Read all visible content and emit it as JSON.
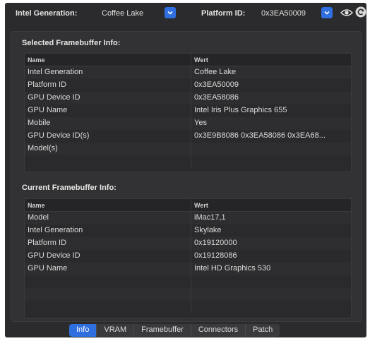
{
  "header": {
    "gen_label": "Intel Generation:",
    "gen_value": "Coffee Lake",
    "platform_label": "Platform ID:",
    "platform_value": "0x3EA50009"
  },
  "selected": {
    "title": "Selected Framebuffer Info:",
    "col_name": "Name",
    "col_value": "Wert",
    "rows": [
      {
        "name": "Intel Generation",
        "value": "Coffee Lake"
      },
      {
        "name": "Platform ID",
        "value": "0x3EA50009"
      },
      {
        "name": "GPU Device ID",
        "value": "0x3EA58086"
      },
      {
        "name": "GPU Name",
        "value": "Intel Iris Plus Graphics 655"
      },
      {
        "name": "Mobile",
        "value": "Yes"
      },
      {
        "name": "GPU Device ID(s)",
        "value": "0x3E9B8086 0x3EA58086 0x3EA68..."
      },
      {
        "name": "Model(s)",
        "value": ""
      }
    ]
  },
  "current": {
    "title": "Current Framebuffer Info:",
    "col_name": "Name",
    "col_value": "Wert",
    "rows": [
      {
        "name": "Model",
        "value": "iMac17,1"
      },
      {
        "name": "Intel Generation",
        "value": "Skylake"
      },
      {
        "name": "Platform ID",
        "value": "0x19120000"
      },
      {
        "name": "GPU Device ID",
        "value": "0x19128086"
      },
      {
        "name": "GPU Name",
        "value": "Intel HD Graphics 530"
      }
    ]
  },
  "tabs": [
    "Info",
    "VRAM",
    "Framebuffer",
    "Connectors",
    "Patch"
  ],
  "active_tab": "Info",
  "colors": {
    "accent": "#2f6fe0",
    "background": "#2b2b2d"
  }
}
